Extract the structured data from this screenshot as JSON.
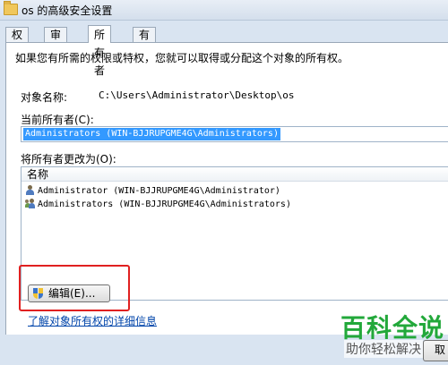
{
  "window": {
    "title": "os 的高级安全设置"
  },
  "tabs": [
    {
      "label": "权限"
    },
    {
      "label": "审核"
    },
    {
      "label": "所有者"
    },
    {
      "label": "有效权限"
    }
  ],
  "owner_tab": {
    "description": "如果您有所需的权限或特权，您就可以取得或分配这个对象的所有权。",
    "object_name_label": "对象名称:",
    "object_path": "C:\\Users\\Administrator\\Desktop\\os",
    "current_owner_label": "当前所有者(C):",
    "current_owner_value": "Administrators (WIN-BJJRUPGME4G\\Administrators)",
    "change_owner_label": "将所有者更改为(O):",
    "list_header": "名称",
    "owners": [
      {
        "name": "Administrator (WIN-BJJRUPGME4G\\Administrator)",
        "icon": "user-icon"
      },
      {
        "name": "Administrators (WIN-BJJRUPGME4G\\Administrators)",
        "icon": "group-icon"
      }
    ],
    "edit_button": "编辑(E)...",
    "more_info_link": "了解对象所有权的详细信息"
  },
  "footer": {
    "cancel_fragment": "取"
  },
  "watermark": {
    "title": "百科全说",
    "subtitle": "助你轻松解决"
  },
  "colors": {
    "selection": "#3399ff",
    "highlight": "#e02020",
    "watermark": "#22a83a",
    "link": "#0044aa"
  }
}
